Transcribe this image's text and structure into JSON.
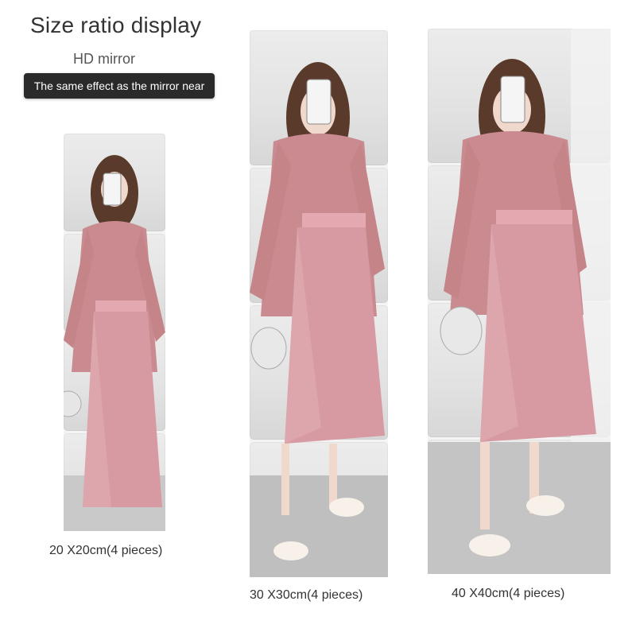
{
  "header": {
    "title": "Size ratio display",
    "subtitle": "HD mirror",
    "banner": "The same effect as the mirror near"
  },
  "products": [
    {
      "size_label": "20 X20cm(4 pieces)"
    },
    {
      "size_label": "30 X30cm(4 pieces)"
    },
    {
      "size_label": "40 X40cm(4 pieces)"
    }
  ],
  "colors": {
    "dress": "#d79aa2",
    "blouse": "#c98a90",
    "hair": "#5a3a2a",
    "floor": "#bfbfbf"
  }
}
